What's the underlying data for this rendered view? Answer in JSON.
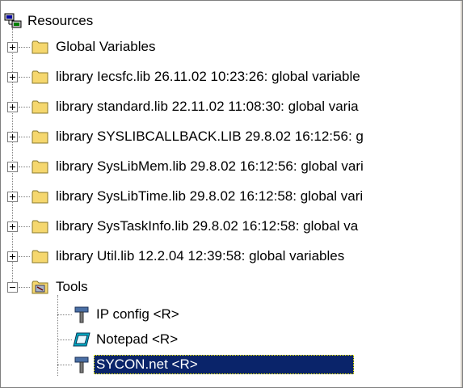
{
  "tree": {
    "root": {
      "label": "Resources",
      "icon": "resources-icon"
    },
    "folders": [
      {
        "label": "Global Variables",
        "icon": "folder-icon",
        "expanded": false
      },
      {
        "label": "library Iecsfc.lib 26.11.02 10:23:26: global variable",
        "icon": "folder-icon",
        "expanded": false
      },
      {
        "label": "library standard.lib 22.11.02 11:08:30: global varia",
        "icon": "folder-icon",
        "expanded": false
      },
      {
        "label": "library SYSLIBCALLBACK.LIB 29.8.02 16:12:56: g",
        "icon": "folder-icon",
        "expanded": false
      },
      {
        "label": "library SysLibMem.lib 29.8.02 16:12:56: global vari",
        "icon": "folder-icon",
        "expanded": false
      },
      {
        "label": "library SysLibTime.lib 29.8.02 16:12:58: global vari",
        "icon": "folder-icon",
        "expanded": false
      },
      {
        "label": "library SysTaskInfo.lib 29.8.02 16:12:58: global va",
        "icon": "folder-icon",
        "expanded": false
      },
      {
        "label": "library Util.lib 12.2.04 12:39:58: global variables",
        "icon": "folder-icon",
        "expanded": false
      }
    ],
    "tools": {
      "label": "Tools",
      "icon": "tools-folder-icon",
      "expanded": true,
      "items": [
        {
          "label": "IP config <R>",
          "icon": "hammer-icon",
          "selected": false
        },
        {
          "label": "Notepad <R>",
          "icon": "notepad-icon",
          "selected": false
        },
        {
          "label": "SYCON.net <R>",
          "icon": "hammer-icon",
          "selected": true
        }
      ]
    }
  },
  "colors": {
    "selection": "#0a246a",
    "folder": "#f5d76e",
    "line": "#808080"
  }
}
